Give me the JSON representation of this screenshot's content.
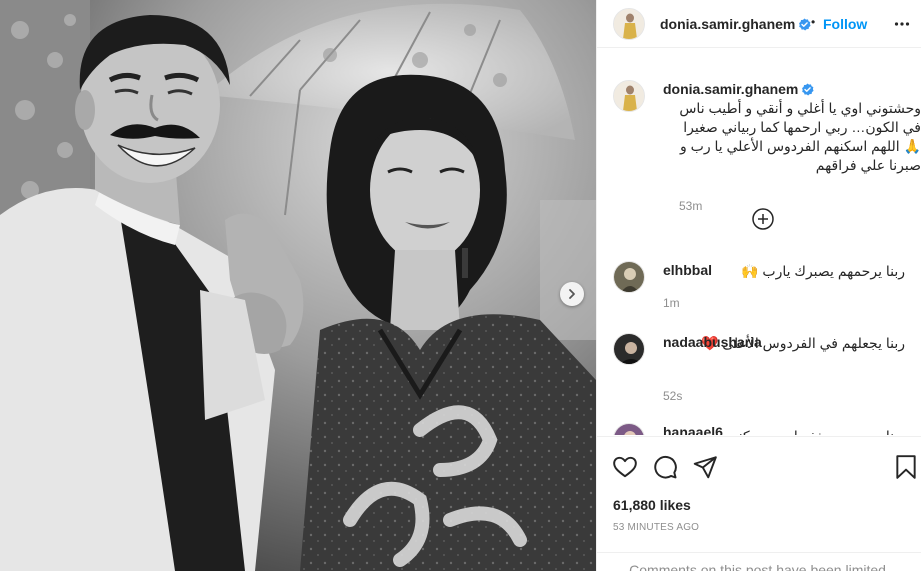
{
  "post": {
    "author": "donia.samir.ghanem",
    "follow_label": "Follow",
    "separator": "•",
    "caption_username": "donia.samir.ghanem",
    "caption_text": "وحشتوني اوي يا أغلي و أنقي و أطيب ناس في الكون… ربي ارحمها كما ربياني صغيرا 🙏 اللهم اسكنهم الفردوس الأعلي يا رب و صبرنا علي فراقهم",
    "caption_time": "53m",
    "likes": "61,880 likes",
    "posted_ago": "53 MINUTES AGO",
    "limited_notice": "Comments on this post have been limited."
  },
  "comments": [
    {
      "username": "elhbbal",
      "text": "ربنا يرحمهم يصبرك يارب 🙌",
      "time": "1m"
    },
    {
      "username": "nadaabusharia",
      "text": "ربنا يجعلهم في الفردوس الأعلى ❤️",
      "time": "52s"
    },
    {
      "username": "hanaael6",
      "text": "ربنا يرحمهم ويغفر لهم ويسكنهم",
      "time": ""
    }
  ],
  "icons": {
    "verified": "verified-badge-icon",
    "more": "more-options-icon",
    "load_more": "plus-circle-icon",
    "like": "heart-icon",
    "comment": "comment-bubble-icon",
    "share": "paper-plane-icon",
    "save": "bookmark-icon",
    "carousel_next": "chevron-right-icon"
  },
  "colors": {
    "accent": "#0095f6",
    "text": "#262626",
    "muted": "#8e8e8e",
    "border": "#efefef"
  }
}
